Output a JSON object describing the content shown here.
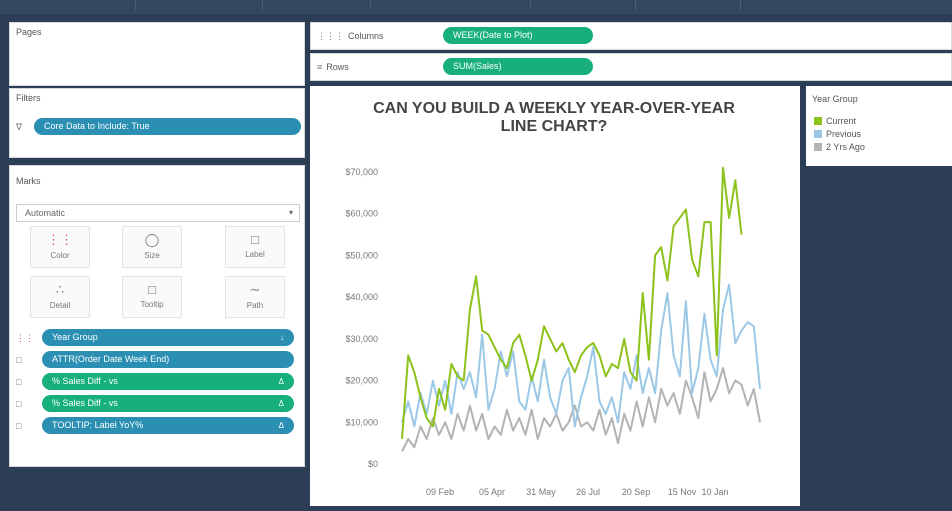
{
  "pages": {
    "title": "Pages"
  },
  "filters": {
    "title": "Filters",
    "items": [
      {
        "label": "Core Data to Include: True"
      }
    ]
  },
  "columns_shelf": {
    "label": "Columns",
    "pill": "WEEK(Date to Plot)"
  },
  "rows_shelf": {
    "label": "Rows",
    "pill": "SUM(Sales)"
  },
  "marks": {
    "title": "Marks",
    "type": "Automatic",
    "buttons": [
      {
        "label": "Color",
        "icon": "color-icon"
      },
      {
        "label": "Size",
        "icon": "size-icon"
      },
      {
        "label": "Label",
        "icon": "label-icon"
      },
      {
        "label": "Detail",
        "icon": "detail-icon"
      },
      {
        "label": "Tooltip",
        "icon": "tooltip-icon"
      },
      {
        "label": "Path",
        "icon": "path-icon"
      }
    ],
    "fields": [
      {
        "label": "Year Group",
        "color": "blue",
        "icon": "color-dots-icon"
      },
      {
        "label": "ATTR(Order Date Week End)",
        "color": "blue",
        "icon": "tooltip-icon"
      },
      {
        "label": "% Sales Diff - vs",
        "color": "green",
        "icon": "tooltip-icon"
      },
      {
        "label": "% Sales Diff - vs",
        "color": "green",
        "icon": "tooltip-icon"
      },
      {
        "label": "TOOLTIP: Label YoY%",
        "color": "blue",
        "icon": "tooltip-icon"
      }
    ]
  },
  "legend": {
    "title": "Year Group",
    "items": [
      {
        "label": "Current",
        "color": "#8cc21b"
      },
      {
        "label": "Previous",
        "color": "#9cc8e8"
      },
      {
        "label": "2 Yrs Ago",
        "color": "#b3b3b3"
      }
    ]
  },
  "chart_data": {
    "type": "line",
    "title": "CAN YOU BUILD A WEEKLY YEAR-OVER-YEAR LINE CHART?",
    "xlabel": "",
    "ylabel": "",
    "y_ticks": [
      "$70,000",
      "$60,000",
      "$50,000",
      "$40,000",
      "$30,000",
      "$20,000",
      "$10,000",
      "$0"
    ],
    "x_ticks": [
      "09 Feb",
      "05 Apr",
      "31 May",
      "26 Jul",
      "20 Sep",
      "15 Nov",
      "10 Jan"
    ],
    "ylim": [
      0,
      70000
    ],
    "grid": false,
    "series": [
      {
        "name": "Current",
        "color": "#8cc21b",
        "values": [
          6000,
          26000,
          22000,
          16000,
          11000,
          9000,
          18000,
          13000,
          24000,
          21000,
          20000,
          37000,
          45000,
          32000,
          31000,
          28000,
          25000,
          23000,
          29000,
          31000,
          26000,
          20000,
          25000,
          33000,
          30000,
          27000,
          29000,
          25000,
          22000,
          26000,
          28000,
          29000,
          26000,
          21000,
          24000,
          23000,
          30000,
          22000,
          20000,
          41000,
          25000,
          50000,
          52000,
          44000,
          57000,
          59000,
          61000,
          49000,
          45000,
          58000,
          58000,
          26000,
          71000,
          59000,
          68000,
          55000
        ]
      },
      {
        "name": "Previous",
        "color": "#9cc8e8",
        "values": [
          10000,
          15000,
          9000,
          17000,
          12000,
          20000,
          14000,
          20000,
          12000,
          22000,
          18000,
          22000,
          16000,
          31000,
          13000,
          18000,
          27000,
          21000,
          27000,
          15000,
          13000,
          21000,
          15000,
          25000,
          16000,
          12000,
          20000,
          23000,
          9000,
          16000,
          21000,
          28000,
          15000,
          12000,
          16000,
          10000,
          22000,
          18000,
          26000,
          17000,
          23000,
          17000,
          32000,
          41000,
          26000,
          21000,
          39000,
          17000,
          23000,
          36000,
          25000,
          21000,
          37000,
          43000,
          29000,
          32000,
          34000,
          33000,
          18000
        ]
      },
      {
        "name": "2 Yrs Ago",
        "color": "#b3b3b3",
        "values": [
          3000,
          6000,
          4000,
          9000,
          6000,
          11000,
          7000,
          10000,
          6000,
          12000,
          8000,
          14000,
          8000,
          12000,
          6000,
          9000,
          7000,
          13000,
          8000,
          11000,
          7000,
          13000,
          6000,
          11000,
          9000,
          12000,
          8000,
          10000,
          14000,
          9000,
          10000,
          8000,
          13000,
          7000,
          11000,
          5000,
          12000,
          8000,
          15000,
          9000,
          16000,
          10000,
          18000,
          14000,
          17000,
          12000,
          20000,
          16000,
          11000,
          22000,
          15000,
          18000,
          23000,
          17000,
          20000,
          19000,
          14000,
          18000,
          10000
        ]
      }
    ]
  }
}
